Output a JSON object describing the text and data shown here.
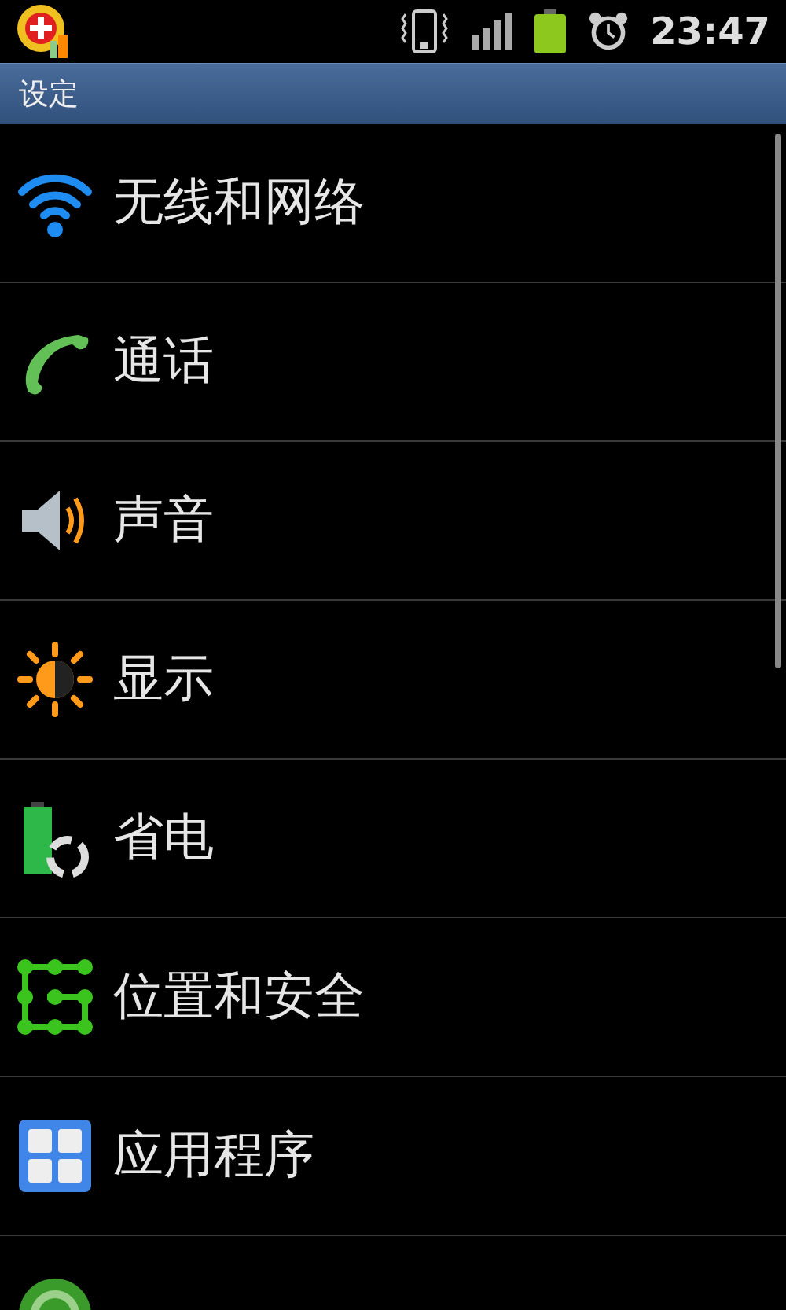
{
  "status_bar": {
    "time": "23:47"
  },
  "title_bar": {
    "title": "设定"
  },
  "settings": [
    {
      "label": "无线和网络"
    },
    {
      "label": "通话"
    },
    {
      "label": "声音"
    },
    {
      "label": "显示"
    },
    {
      "label": "省电"
    },
    {
      "label": "位置和安全"
    },
    {
      "label": "应用程序"
    }
  ],
  "partly_shown_item": true
}
